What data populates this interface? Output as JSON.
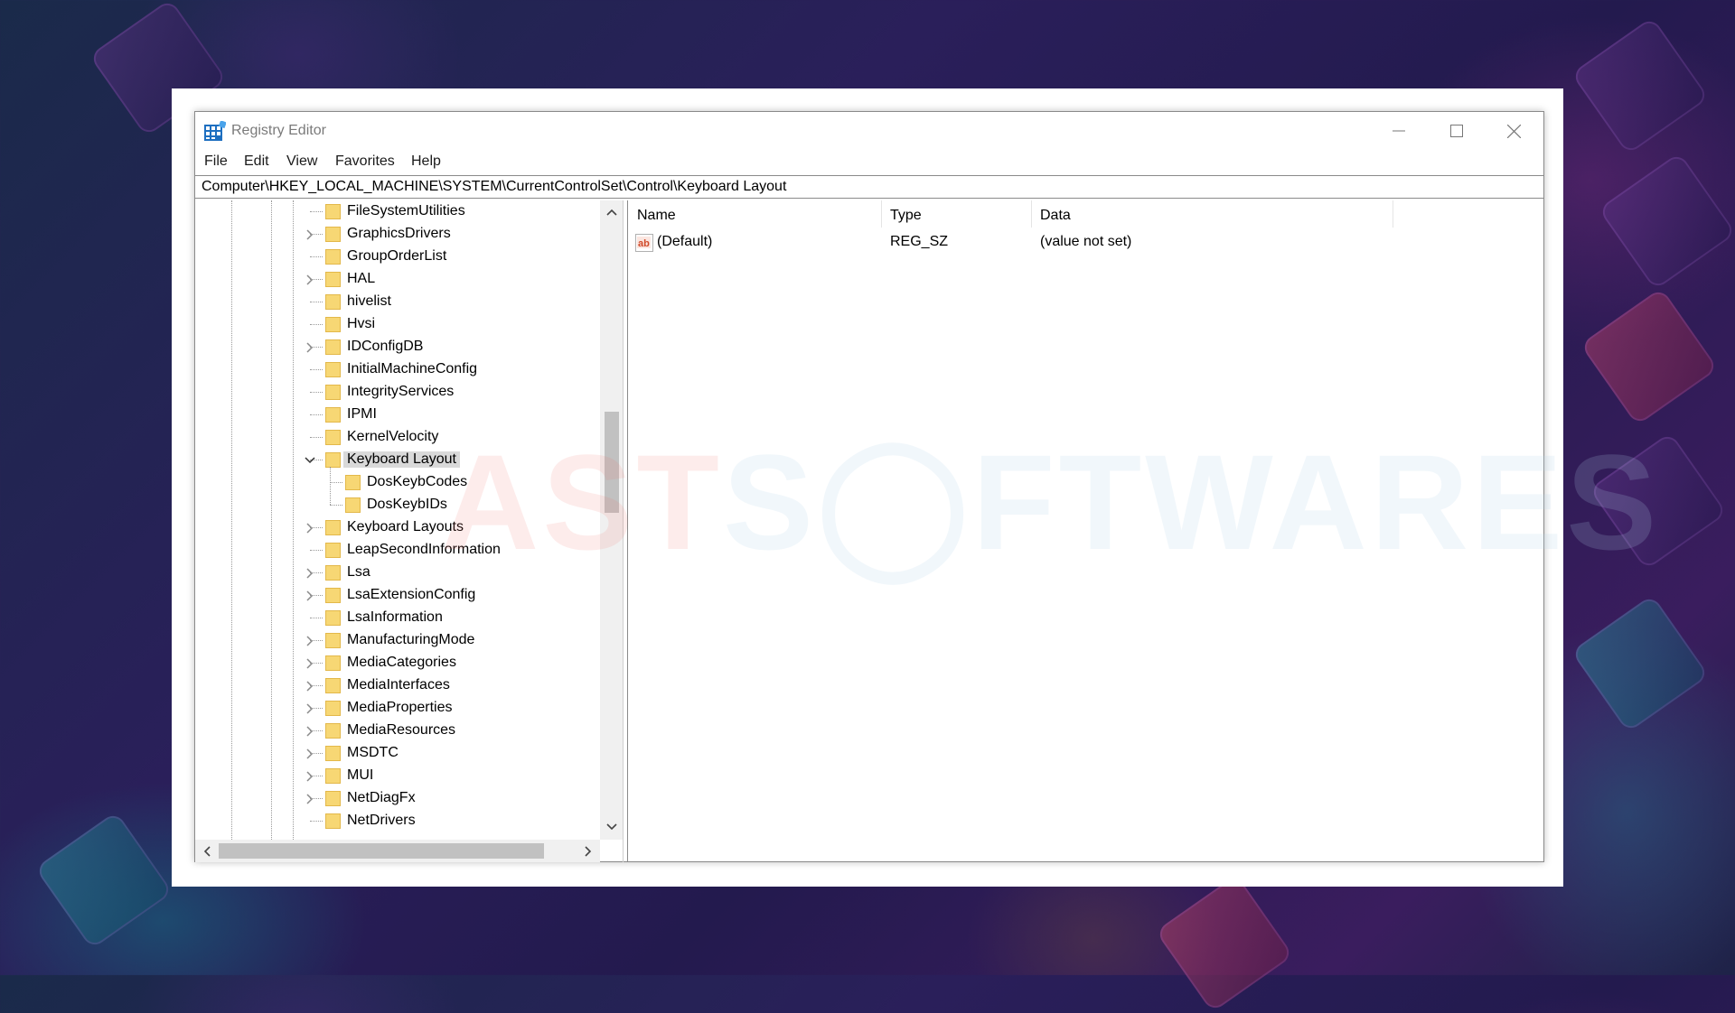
{
  "window": {
    "title": "Registry Editor",
    "icon": "registry-editor-icon",
    "controls": [
      "minimize-icon",
      "maximize-icon",
      "close-icon"
    ]
  },
  "menu": [
    "File",
    "Edit",
    "View",
    "Favorites",
    "Help"
  ],
  "address": "Computer\\HKEY_LOCAL_MACHINE\\SYSTEM\\CurrentControlSet\\Control\\Keyboard Layout",
  "tree": {
    "items": [
      {
        "label": "FileSystemUtilities",
        "level": 0,
        "expander": "none"
      },
      {
        "label": "GraphicsDrivers",
        "level": 0,
        "expander": "collapsed"
      },
      {
        "label": "GroupOrderList",
        "level": 0,
        "expander": "none"
      },
      {
        "label": "HAL",
        "level": 0,
        "expander": "collapsed"
      },
      {
        "label": "hivelist",
        "level": 0,
        "expander": "none"
      },
      {
        "label": "Hvsi",
        "level": 0,
        "expander": "none"
      },
      {
        "label": "IDConfigDB",
        "level": 0,
        "expander": "collapsed"
      },
      {
        "label": "InitialMachineConfig",
        "level": 0,
        "expander": "none"
      },
      {
        "label": "IntegrityServices",
        "level": 0,
        "expander": "none"
      },
      {
        "label": "IPMI",
        "level": 0,
        "expander": "none"
      },
      {
        "label": "KernelVelocity",
        "level": 0,
        "expander": "none"
      },
      {
        "label": "Keyboard Layout",
        "level": 0,
        "expander": "expanded",
        "selected": true
      },
      {
        "label": "DosKeybCodes",
        "level": 1,
        "expander": "none"
      },
      {
        "label": "DosKeybIDs",
        "level": 1,
        "expander": "none"
      },
      {
        "label": "Keyboard Layouts",
        "level": 0,
        "expander": "collapsed"
      },
      {
        "label": "LeapSecondInformation",
        "level": 0,
        "expander": "none"
      },
      {
        "label": "Lsa",
        "level": 0,
        "expander": "collapsed"
      },
      {
        "label": "LsaExtensionConfig",
        "level": 0,
        "expander": "collapsed"
      },
      {
        "label": "LsaInformation",
        "level": 0,
        "expander": "none"
      },
      {
        "label": "ManufacturingMode",
        "level": 0,
        "expander": "collapsed"
      },
      {
        "label": "MediaCategories",
        "level": 0,
        "expander": "collapsed"
      },
      {
        "label": "MediaInterfaces",
        "level": 0,
        "expander": "collapsed"
      },
      {
        "label": "MediaProperties",
        "level": 0,
        "expander": "collapsed"
      },
      {
        "label": "MediaResources",
        "level": 0,
        "expander": "collapsed"
      },
      {
        "label": "MSDTC",
        "level": 0,
        "expander": "collapsed"
      },
      {
        "label": "MUI",
        "level": 0,
        "expander": "collapsed"
      },
      {
        "label": "NetDiagFx",
        "level": 0,
        "expander": "collapsed"
      },
      {
        "label": "NetDrivers",
        "level": 0,
        "expander": "none"
      }
    ]
  },
  "columns": {
    "name": "Name",
    "type": "Type",
    "data": "Data"
  },
  "values": [
    {
      "name": "(Default)",
      "type": "REG_SZ",
      "data": "(value not set)",
      "icon": "string-value-icon"
    }
  ],
  "watermark": {
    "part1": "AST",
    "part2": "S",
    "part3": "FTWARES"
  },
  "colors": {
    "folder": "#f7d774",
    "selection": "#d9d9d9",
    "title_text": "#7a7a7a"
  }
}
